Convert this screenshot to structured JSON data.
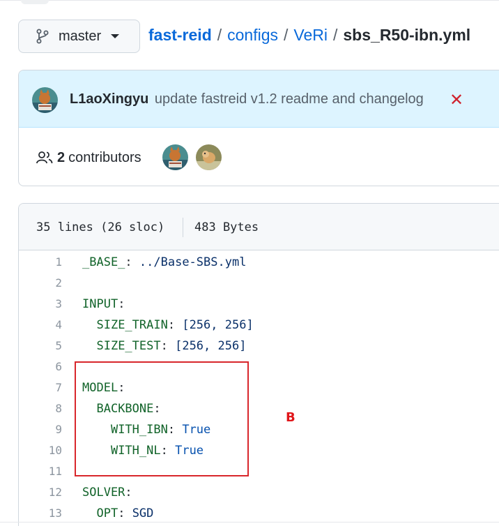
{
  "repo": {
    "branch": "master",
    "breadcrumb": [
      "fast-reid",
      "configs",
      "VeRi"
    ],
    "file_name": "sbs_R50-ibn.yml",
    "separator": "/"
  },
  "commit": {
    "author": "L1aoXingyu",
    "message": "update fastreid v1.2 readme and changelog",
    "status_symbol": "✕",
    "status_color": "#cf222e"
  },
  "contributors": {
    "count": "2",
    "label": "contributors"
  },
  "file": {
    "lines_info": "35 lines (26 sloc)",
    "size": "483 Bytes",
    "lines": [
      {
        "n": "1",
        "tokens": [
          {
            "t": "_BASE_",
            "c": "k"
          },
          {
            "t": ": ",
            "c": "p"
          },
          {
            "t": "../Base-SBS.yml",
            "c": "s"
          }
        ]
      },
      {
        "n": "2",
        "tokens": []
      },
      {
        "n": "3",
        "tokens": [
          {
            "t": "INPUT",
            "c": "k"
          },
          {
            "t": ":",
            "c": "p"
          }
        ]
      },
      {
        "n": "4",
        "tokens": [
          {
            "t": "  ",
            "c": "p"
          },
          {
            "t": "SIZE_TRAIN",
            "c": "k"
          },
          {
            "t": ": ",
            "c": "p"
          },
          {
            "t": "[256, 256]",
            "c": "s"
          }
        ]
      },
      {
        "n": "5",
        "tokens": [
          {
            "t": "  ",
            "c": "p"
          },
          {
            "t": "SIZE_TEST",
            "c": "k"
          },
          {
            "t": ": ",
            "c": "p"
          },
          {
            "t": "[256, 256]",
            "c": "s"
          }
        ]
      },
      {
        "n": "6",
        "tokens": []
      },
      {
        "n": "7",
        "tokens": [
          {
            "t": "MODEL",
            "c": "k"
          },
          {
            "t": ":",
            "c": "p"
          }
        ]
      },
      {
        "n": "8",
        "tokens": [
          {
            "t": "  ",
            "c": "p"
          },
          {
            "t": "BACKBONE",
            "c": "k"
          },
          {
            "t": ":",
            "c": "p"
          }
        ]
      },
      {
        "n": "9",
        "tokens": [
          {
            "t": "    ",
            "c": "p"
          },
          {
            "t": "WITH_IBN",
            "c": "k"
          },
          {
            "t": ": ",
            "c": "p"
          },
          {
            "t": "True",
            "c": "c"
          }
        ]
      },
      {
        "n": "10",
        "tokens": [
          {
            "t": "    ",
            "c": "p"
          },
          {
            "t": "WITH_NL",
            "c": "k"
          },
          {
            "t": ": ",
            "c": "p"
          },
          {
            "t": "True",
            "c": "c"
          }
        ]
      },
      {
        "n": "11",
        "tokens": []
      },
      {
        "n": "12",
        "tokens": [
          {
            "t": "SOLVER",
            "c": "k"
          },
          {
            "t": ":",
            "c": "p"
          }
        ]
      },
      {
        "n": "13",
        "tokens": [
          {
            "t": "  ",
            "c": "p"
          },
          {
            "t": "OPT",
            "c": "k"
          },
          {
            "t": ": ",
            "c": "p"
          },
          {
            "t": "SGD",
            "c": "s"
          }
        ]
      }
    ]
  },
  "annotation": {
    "label": "B",
    "color": "#d8262b"
  },
  "icons": {
    "branch": "git-branch-icon",
    "caret": "chevron-down-icon",
    "people": "people-icon",
    "status": "x-icon"
  }
}
